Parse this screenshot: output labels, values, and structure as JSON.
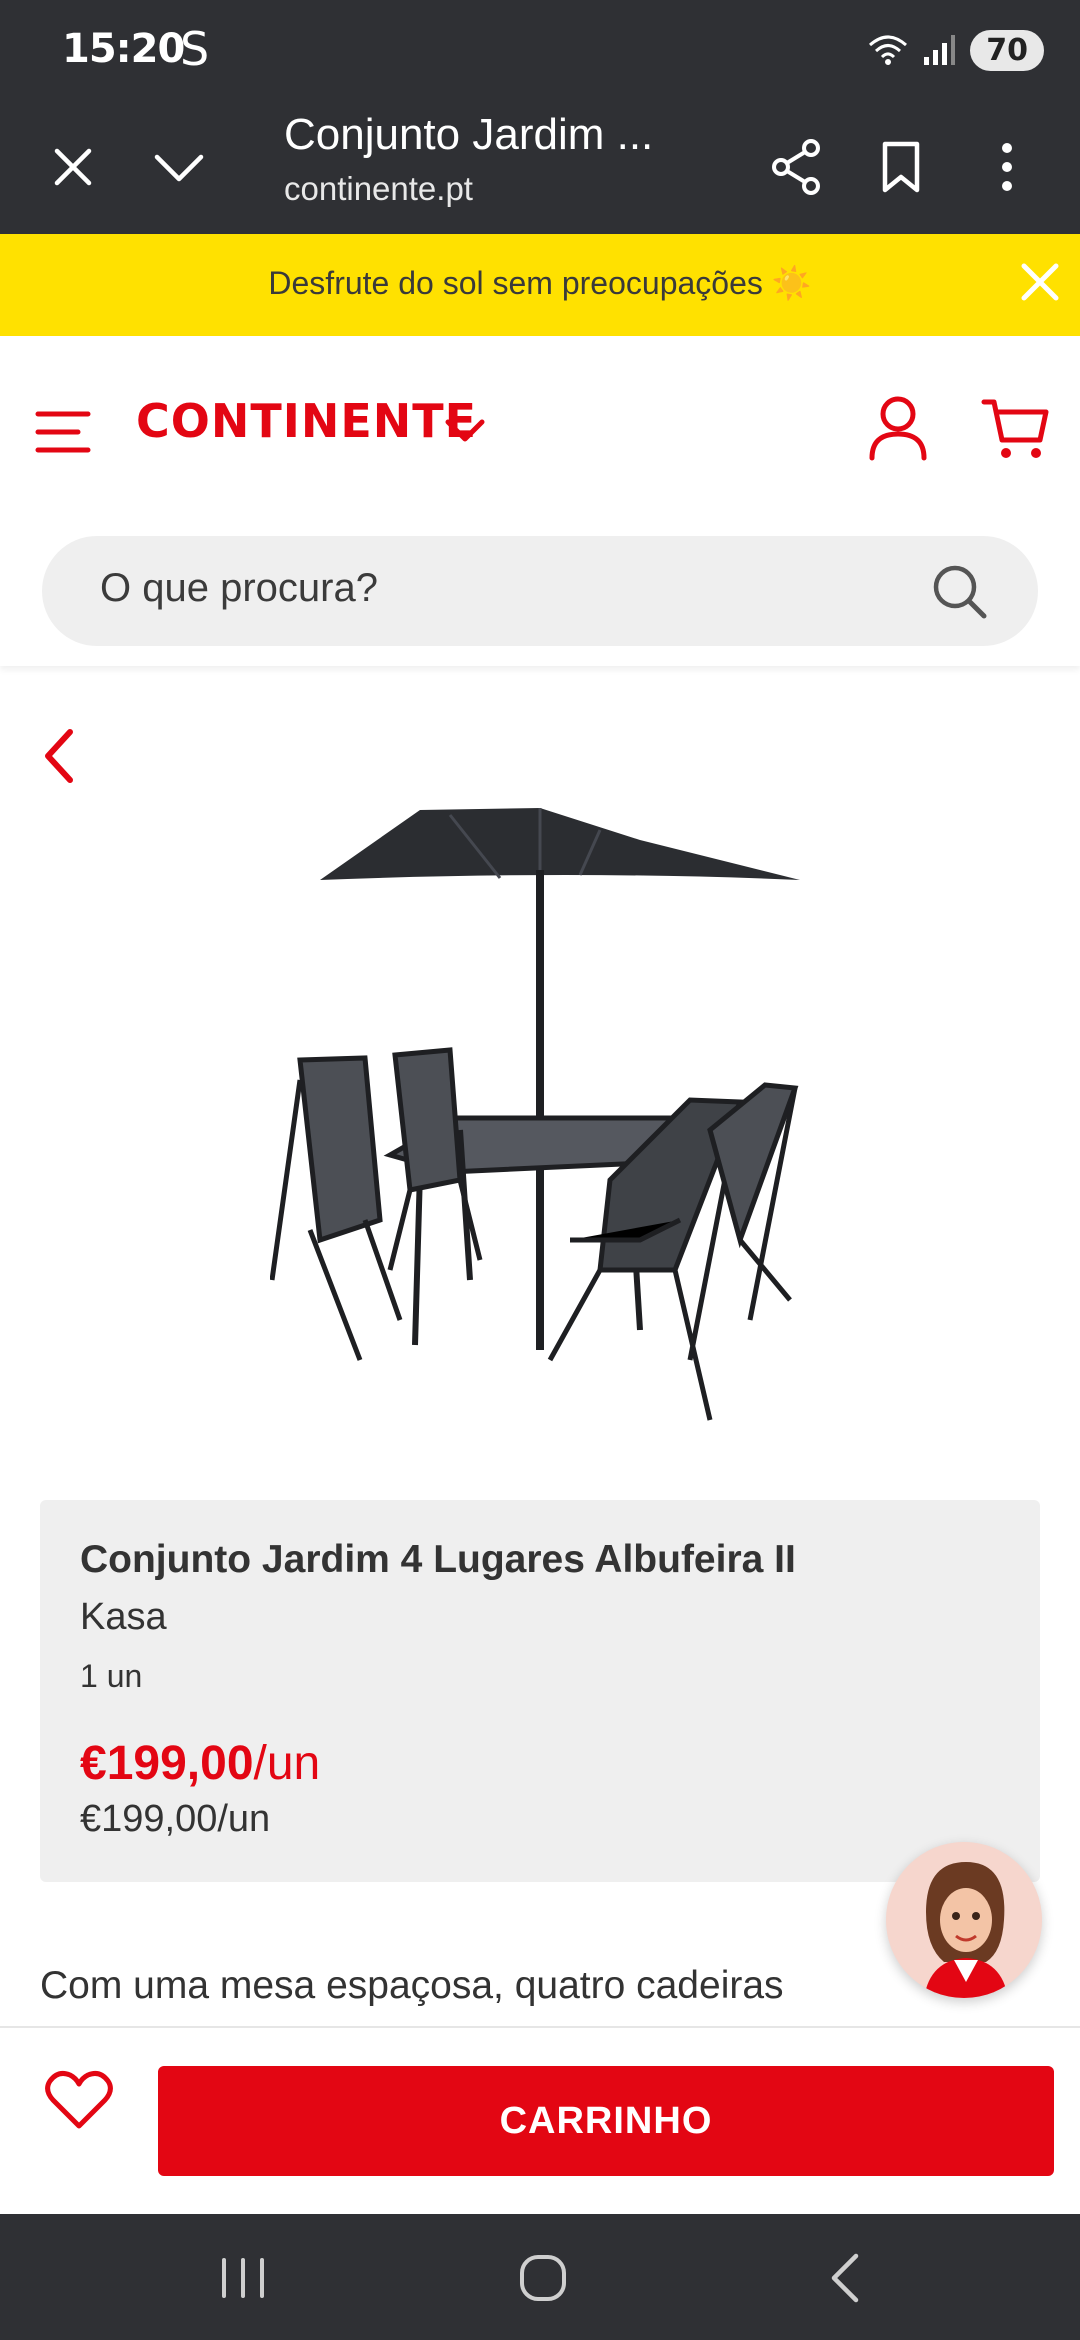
{
  "status_bar": {
    "time": "15:20",
    "carrier_glyph": "S",
    "battery": "70",
    "icons": [
      "wifi-icon",
      "signal-icon"
    ]
  },
  "browser": {
    "tab_title": "Conjunto Jardim ...",
    "url": "continente.pt",
    "icons": [
      "close-icon",
      "chevron-down-icon",
      "share-icon",
      "bookmark-icon",
      "more-vert-icon"
    ]
  },
  "promo": {
    "text": "Desfrute do sol sem preocupações ☀️"
  },
  "header": {
    "logo": "CONTINENTE",
    "search_placeholder": "O que procura?"
  },
  "product": {
    "name": "Conjunto Jardim 4 Lugares Albufeira II",
    "brand": "Kasa",
    "quantity": "1 un",
    "price_amount": "€199,00",
    "price_unit": "/un",
    "unit_price": "€199,00/un",
    "description_preview": "Com uma mesa espaçosa, quatro cadeiras"
  },
  "actions": {
    "cart_button": "CARRINHO"
  },
  "colors": {
    "brand_red": "#e30613",
    "promo_yellow": "#ffe100",
    "chrome_dark": "#2f3034"
  }
}
